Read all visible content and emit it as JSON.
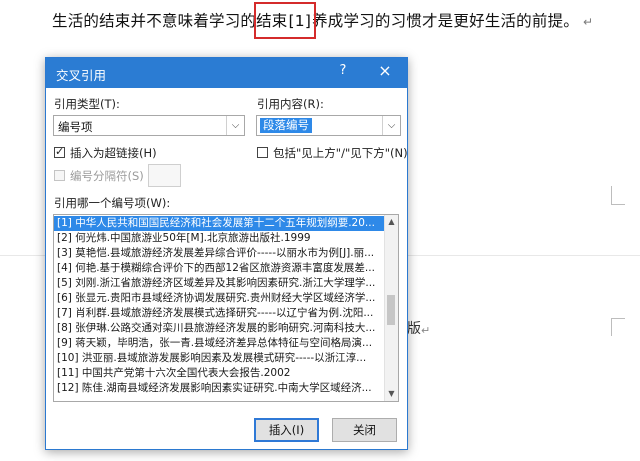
{
  "document": {
    "text_before": "生活的结束并不意味着学习的结束",
    "citation": "[1]",
    "text_after": "养成学习的习惯才是更好生活的前提。",
    "para_mark": "↵",
    "fragment": "版",
    "fragment_mark": "↵"
  },
  "dialog": {
    "title": "交叉引用",
    "help_label": "?",
    "close_label": "×",
    "ref_type_label": "引用类型(T):",
    "ref_type_value": "编号项",
    "ref_content_label": "引用内容(R):",
    "ref_content_value": "段落编号",
    "hyperlink_label": "插入为超链接(H)",
    "hyperlink_checked": true,
    "above_below_label": "包括\"见上方\"/\"见下方\"(N)",
    "above_below_checked": false,
    "separator_label": "编号分隔符(S)",
    "which_label": "引用哪一个编号项(W):",
    "items": [
      "[1] 中华人民共和国国民经济和社会发展第十二个五年规划纲要.20...",
      "[2] 何光炜.中国旅游业50年[M].北京旅游出版社.1999",
      "[3] 莫艳恺.县域旅游经济发展差异综合评价-----以丽水市为例[J].丽...",
      "[4] 何艳.基于模糊综合评价下的西部12省区旅游资源丰富度发展差...",
      "[5] 刘刚.浙江省旅游经济区域差异及其影响因素研究.浙江大学理学...",
      "[6] 张显元.贵阳市县域经济协调发展研究.贵州财经大学区域经济学...",
      "[7] 肖利群.县域旅游经济发展模式选择研究-----以辽宁省为例.沈阳...",
      "[8] 张伊琳.公路交通对栾川县旅游经济发展的影响研究.河南科技大...",
      "[9] 蒋天颖，毕明浩，张一青.县域经济差异总体特征与空间格局演...",
      "[10] 洪亚丽.县域旅游发展影响因素及发展模式研究-----以浙江淳...",
      "[11] 中国共产党第十六次全国代表大会报告.2002",
      "[12] 陈佳.湖南县域经济发展影响因素实证研究.中南大学区域经济..."
    ],
    "insert_button": "插入(I)",
    "close_button": "关闭"
  }
}
